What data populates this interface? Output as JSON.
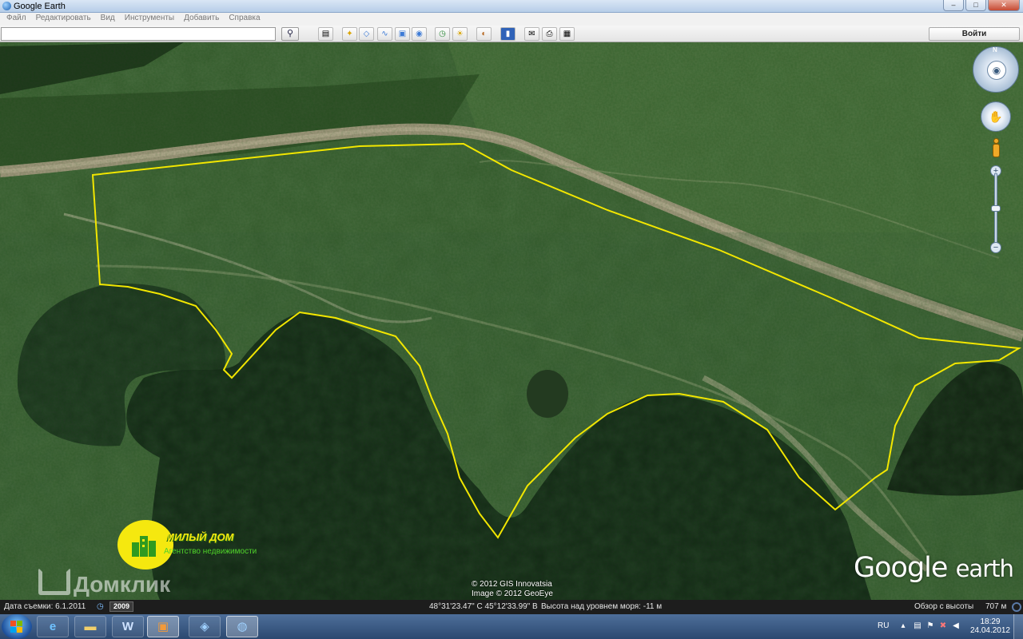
{
  "window": {
    "title": "Google Earth"
  },
  "menu": [
    "Файл",
    "Редактировать",
    "Вид",
    "Инструменты",
    "Добавить",
    "Справка"
  ],
  "toolbar": {
    "search_value": "",
    "search_icon": "magnifier-icon",
    "signin_label": "Войти"
  },
  "map": {
    "copyright_line1": "© 2012 GIS Innovatsia",
    "copyright_line2": "Image © 2012 GeoEye",
    "logo_google": "Google",
    "logo_earth": "earth",
    "compass_letter": "N",
    "boundary_color": "#f2e600"
  },
  "watermarks": {
    "agency_name": "МИЛЫЙ ДОМ",
    "agency_sub": "Агентство недвижимости",
    "domclick": "Домклик"
  },
  "status": {
    "capture_date": "Дата съемки: 6.1.2011",
    "year": "2009",
    "coordinates": "48°31'23.47\" С   45°12'33.99\" В",
    "elevation": "Высота над уровнем моря:   -11 м",
    "eye_alt_label": "Обзор с высоты",
    "eye_alt_value": "707 м"
  },
  "taskbar": {
    "apps": [
      "internet-explorer",
      "file-explorer",
      "word",
      "media-player",
      "remote-desktop",
      "google-earth"
    ],
    "word_label": "W",
    "lang": "RU",
    "time": "18:29",
    "date": "24.04.2012"
  }
}
